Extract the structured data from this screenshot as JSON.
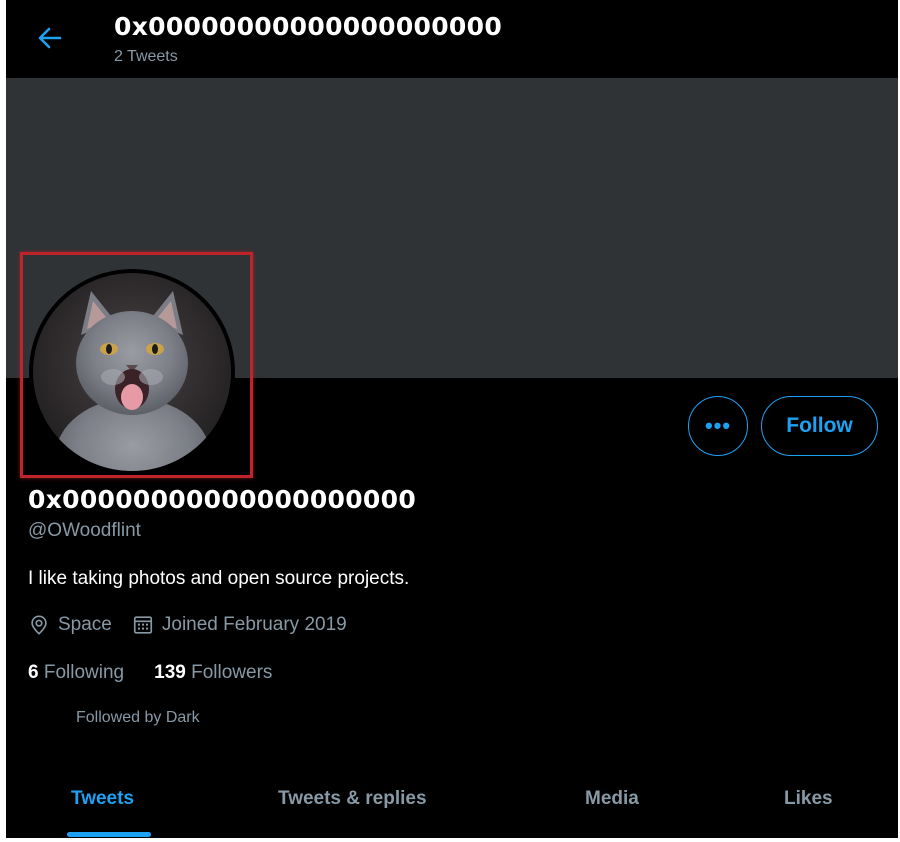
{
  "header": {
    "title": "0x00000000000000000000",
    "tweet_count": "2 Tweets",
    "back_icon": "arrow-left-icon"
  },
  "profile": {
    "display_name": "0x00000000000000000000",
    "handle": "@OWoodflint",
    "bio": "I like taking photos and open source projects.",
    "location": "Space",
    "joined": "Joined February 2019",
    "following_count": "6",
    "following_label": "Following",
    "followers_count": "139",
    "followers_label": "Followers",
    "followed_by": "Followed by Dark",
    "avatar": "gray kitten photo"
  },
  "actions": {
    "more_label": "•••",
    "follow_label": "Follow"
  },
  "tabs": [
    {
      "label": "Tweets",
      "active": true
    },
    {
      "label": "Tweets & replies",
      "active": false
    },
    {
      "label": "Media",
      "active": false
    },
    {
      "label": "Likes",
      "active": false
    }
  ],
  "colors": {
    "accent": "#1da1f2",
    "banner": "#2f3336",
    "muted": "#8899a6",
    "highlight_box": "#c0242b"
  }
}
